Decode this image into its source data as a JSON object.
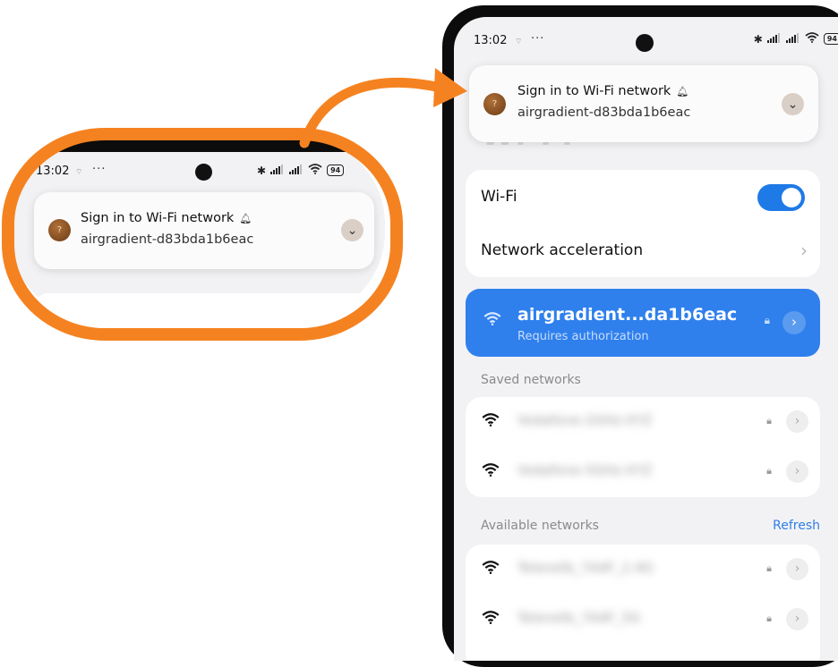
{
  "status_bar": {
    "time": "13:02",
    "mini_icon": "wifi-question-icon",
    "dots": "···",
    "battery": "94",
    "bluetooth_icon": "bluetooth-icon",
    "signal_icon": "cellular-signal-icon",
    "wifi_icon": "wifi-icon"
  },
  "zoom_status": {
    "time": "13:02",
    "battery": "94"
  },
  "notification": {
    "title": "Sign in to Wi-Fi network",
    "subtitle": "airgradient-d83bda1b6eac",
    "bell_icon": "bell-icon",
    "expand_icon": "chevron-down-icon"
  },
  "ghost_title": "Wi-Fi",
  "settings": {
    "wifi_label": "Wi-Fi",
    "wifi_enabled": true,
    "acceleration_label": "Network acceleration"
  },
  "active_network": {
    "name": "airgradient...da1b6eac",
    "status": "Requires authorization"
  },
  "saved_section": {
    "label": "Saved networks",
    "networks": [
      {
        "name": "Vodafone-2GHz-XYZ"
      },
      {
        "name": "Vodafone-5GHz-XYZ"
      }
    ]
  },
  "available_section": {
    "label": "Available networks",
    "refresh_label": "Refresh",
    "networks": [
      {
        "name": "Telenetb_7A4F_2.4G"
      },
      {
        "name": "Telenetb_7A4F_5G"
      }
    ]
  },
  "colors": {
    "accent": "#2f80ed",
    "callout": "#f58220",
    "toggle_on": "#1e7ae6"
  }
}
